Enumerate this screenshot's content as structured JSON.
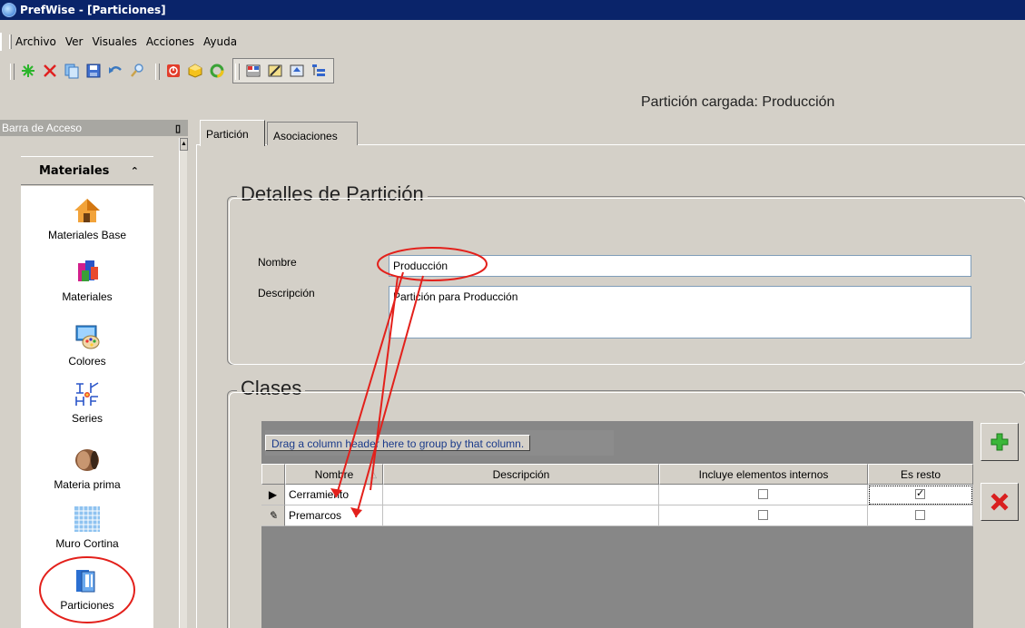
{
  "window": {
    "title": "PrefWise - [Particiones]"
  },
  "menu": {
    "items": [
      "Archivo",
      "Ver",
      "Visuales",
      "Acciones",
      "Ayuda"
    ]
  },
  "toolbar": {
    "group1": [
      "new-icon",
      "delete-icon",
      "copy-icon",
      "save-icon",
      "undo-icon",
      "search-icon"
    ],
    "group2": [
      "stop-icon",
      "cube-icon",
      "refresh-icon"
    ],
    "group3": [
      "view-grid-icon",
      "view-edit-icon",
      "view-move-icon",
      "view-tree-icon"
    ]
  },
  "status": {
    "loaded_partition": "Partición cargada: Producción"
  },
  "sidebar": {
    "header": "Barra de Acceso",
    "pin": "ᵖ",
    "panel_title": "Materiales",
    "collapse_glyph": "ˆ",
    "items": [
      {
        "label": "Materiales Base",
        "icon": "house-icon"
      },
      {
        "label": "Materiales",
        "icon": "materials-icon"
      },
      {
        "label": "Colores",
        "icon": "palette-icon"
      },
      {
        "label": "Series",
        "icon": "series-icon"
      },
      {
        "label": "Materia prima",
        "icon": "raw-material-icon"
      },
      {
        "label": "Muro Cortina",
        "icon": "curtain-wall-icon"
      },
      {
        "label": "Particiones",
        "icon": "partitions-icon"
      }
    ]
  },
  "tabs": [
    {
      "label": "Partición",
      "active": true
    },
    {
      "label": "Asociaciones",
      "active": false
    }
  ],
  "details": {
    "title": "Detalles de Partición",
    "name_label": "Nombre",
    "name_value": "Producción",
    "desc_label": "Descripción",
    "desc_value": "Partición para Producción"
  },
  "classes": {
    "title": "Clases",
    "group_hint": "Drag a column header here to group by that column.",
    "columns": [
      "Nombre",
      "Descripción",
      "Incluye elementos internos",
      "Es resto"
    ],
    "rows": [
      {
        "name": "Cerramiento",
        "description": "",
        "internal": false,
        "rest": true
      },
      {
        "name": "Premarcos",
        "description": "",
        "internal": false,
        "rest": false
      }
    ]
  },
  "colors": {
    "titlebar": "#0a246a",
    "annotation": "#e3201b",
    "face": "#d4d0c8"
  }
}
